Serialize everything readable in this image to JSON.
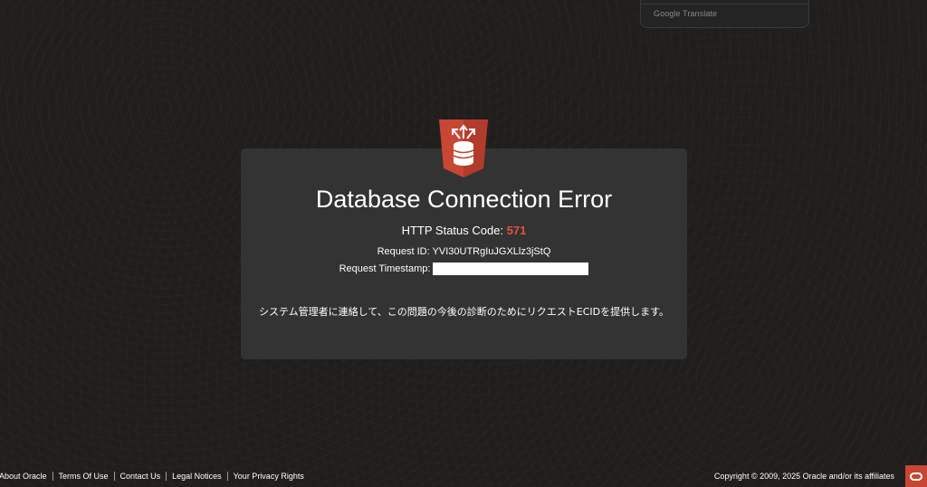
{
  "translate_widget": {
    "label": "Google Translate"
  },
  "error": {
    "title": "Database Connection Error",
    "status_label": "HTTP Status Code:",
    "status_code": "571",
    "request_id_label": "Request ID:",
    "request_id": "YVI30UTRgIuJGXLlz3jStQ",
    "request_timestamp_label": "Request Timestamp:",
    "request_timestamp_value": "",
    "message": "システム管理者に連絡して、この問題の今後の診断のためにリクエストECIDを提供します。"
  },
  "icons": {
    "database_icon": "database-icon",
    "oracle_logo": "oracle-logo-icon"
  },
  "colors": {
    "accent_red": "#c74634",
    "status_code_red": "#e0533e",
    "card_bg": "#333333",
    "page_bg": "#1f1e1c"
  },
  "footer": {
    "links": [
      "About Oracle",
      "Terms Of Use",
      "Contact Us",
      "Legal Notices",
      "Your Privacy Rights"
    ],
    "copyright": "Copyright © 2009, 2025 Oracle and/or its affiliates"
  }
}
